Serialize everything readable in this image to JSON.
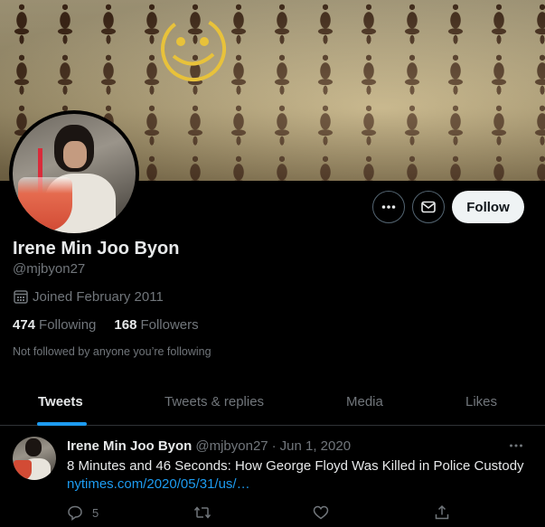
{
  "profile": {
    "name": "Irene Min Joo Byon",
    "handle": "@mjbyon27",
    "joined": "Joined February 2011",
    "following_count": "474",
    "following_label": "Following",
    "followers_count": "168",
    "followers_label": "Followers",
    "not_followed_text": "Not followed by anyone you’re following"
  },
  "actions": {
    "follow_label": "Follow"
  },
  "tabs": [
    {
      "label": "Tweets",
      "active": true
    },
    {
      "label": "Tweets & replies",
      "active": false
    },
    {
      "label": "Media",
      "active": false
    },
    {
      "label": "Likes",
      "active": false
    }
  ],
  "tweet": {
    "author": "Irene Min Joo Byon",
    "handle": "@mjbyon27",
    "separator": "·",
    "date": "Jun 1, 2020",
    "text": "8 Minutes and 46 Seconds: How George Floyd Was Killed in Police Custody",
    "link": "nytimes.com/2020/05/31/us/…",
    "reply_count": "5"
  },
  "icons": [
    "more-icon",
    "mail-icon",
    "calendar-icon",
    "reply-icon",
    "retweet-icon",
    "like-icon",
    "share-icon"
  ],
  "colors": {
    "background": "#000000",
    "accent": "#1d9bf0",
    "text_primary": "#e7e9ea",
    "text_secondary": "#71767b",
    "follow_button_bg": "#eff3f4"
  }
}
